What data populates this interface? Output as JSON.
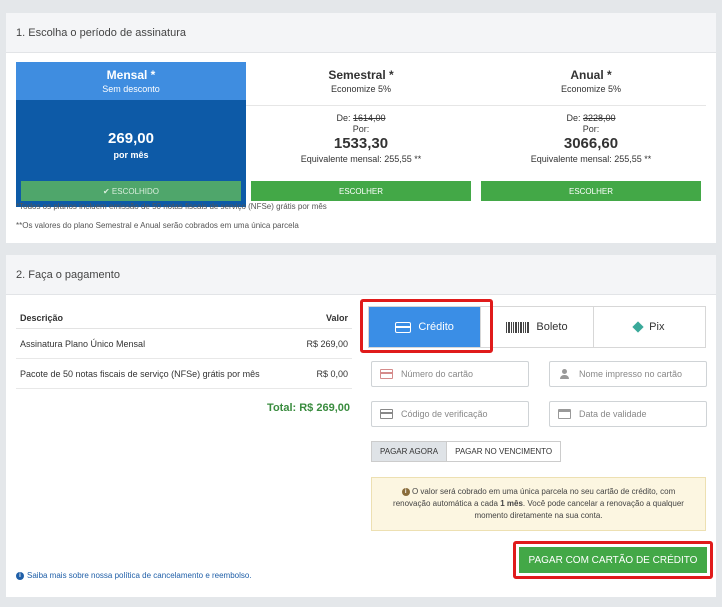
{
  "section1": {
    "title": "1. Escolha o período de assinatura",
    "plans": [
      {
        "name": "Mensal *",
        "subtitle": "Sem desconto",
        "price": "269,00",
        "per": "por mês",
        "button": "✔ ESCOLHIDO"
      },
      {
        "name": "Semestral *",
        "subtitle": "Economize 5%",
        "from_label": "De:",
        "from_price": "1614,00",
        "por": "Por:",
        "price": "1533,30",
        "equiv": "Equivalente mensal: 255,55 **",
        "button": "ESCOLHER"
      },
      {
        "name": "Anual *",
        "subtitle": "Economize 5%",
        "from_label": "De:",
        "from_price": "3228,00",
        "por": "Por:",
        "price": "3066,60",
        "equiv": "Equivalente mensal: 255,55 **",
        "button": "ESCOLHER"
      }
    ],
    "note1": "*Todos os planos incluem emissão de 50 notas fiscais de serviço (NFSe) grátis por mês",
    "note2": "**Os valores do plano Semestral e Anual serão cobrados em uma única parcela"
  },
  "section2": {
    "title": "2. Faça o pagamento",
    "table": {
      "col_desc": "Descrição",
      "col_value": "Valor",
      "rows": [
        {
          "desc": "Assinatura Plano Único Mensal",
          "value": "R$ 269,00"
        },
        {
          "desc": "Pacote de 50 notas fiscais de serviço (NFSe) grátis por mês",
          "value": "R$ 0,00"
        }
      ],
      "total": "Total: R$ 269,00"
    },
    "policy_link": "Saiba mais sobre nossa política de cancelamento e reembolso.",
    "payment_tabs": {
      "credit": "Crédito",
      "boleto": "Boleto",
      "pix": "Pix"
    },
    "fields": {
      "card_number": "Número do cartão",
      "card_name": "Nome impresso no cartão",
      "cvv": "Código de verificação",
      "expiry": "Data de validade"
    },
    "pay_options": {
      "now": "PAGAR AGORA",
      "due": "PAGAR NO VENCIMENTO"
    },
    "alert": {
      "line1": "O valor será cobrado em uma única parcela no seu cartão de crédito, com",
      "line2a": "renovação automática a cada ",
      "line2b": "1 mês",
      "line2c": ". Você pode cancelar a renovação a qualquer",
      "line3": "momento diretamente na sua conta."
    },
    "pay_button": "PAGAR COM CARTÃO DE CRÉDITO"
  },
  "colors": {
    "accent_blue": "#3a8ee6",
    "selected_plan": "#0d5aa7",
    "green": "#43a847",
    "highlight_red": "#e01b1b"
  }
}
